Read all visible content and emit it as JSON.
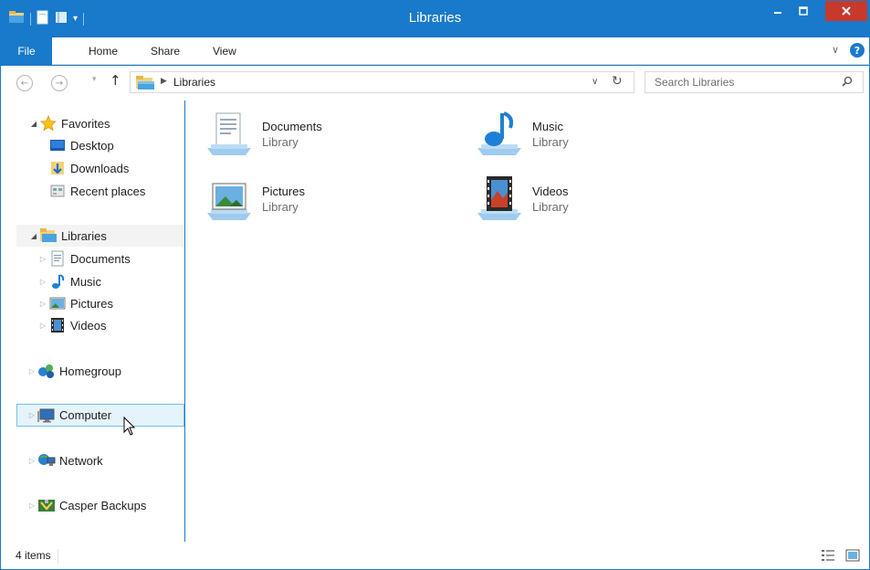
{
  "window": {
    "title": "Libraries",
    "accent": "#1979ca",
    "close_color": "#c7392b"
  },
  "ribbon": {
    "file_label": "File",
    "tabs": [
      "Home",
      "Share",
      "View"
    ]
  },
  "address_bar": {
    "path": [
      "Libraries"
    ]
  },
  "search": {
    "placeholder": "Search Libraries"
  },
  "nav_pane": {
    "favorites": {
      "label": "Favorites",
      "items": [
        "Desktop",
        "Downloads",
        "Recent places"
      ]
    },
    "libraries": {
      "label": "Libraries",
      "items": [
        "Documents",
        "Music",
        "Pictures",
        "Videos"
      ]
    },
    "homegroup": "Homegroup",
    "computer": "Computer",
    "network": "Network",
    "casper": "Casper Backups"
  },
  "content": {
    "libraries": [
      {
        "name": "Documents",
        "type": "Library",
        "icon": "documents-library-icon"
      },
      {
        "name": "Music",
        "type": "Library",
        "icon": "music-library-icon"
      },
      {
        "name": "Pictures",
        "type": "Library",
        "icon": "pictures-library-icon"
      },
      {
        "name": "Videos",
        "type": "Library",
        "icon": "videos-library-icon"
      }
    ]
  },
  "status": {
    "item_count": "4 items"
  }
}
